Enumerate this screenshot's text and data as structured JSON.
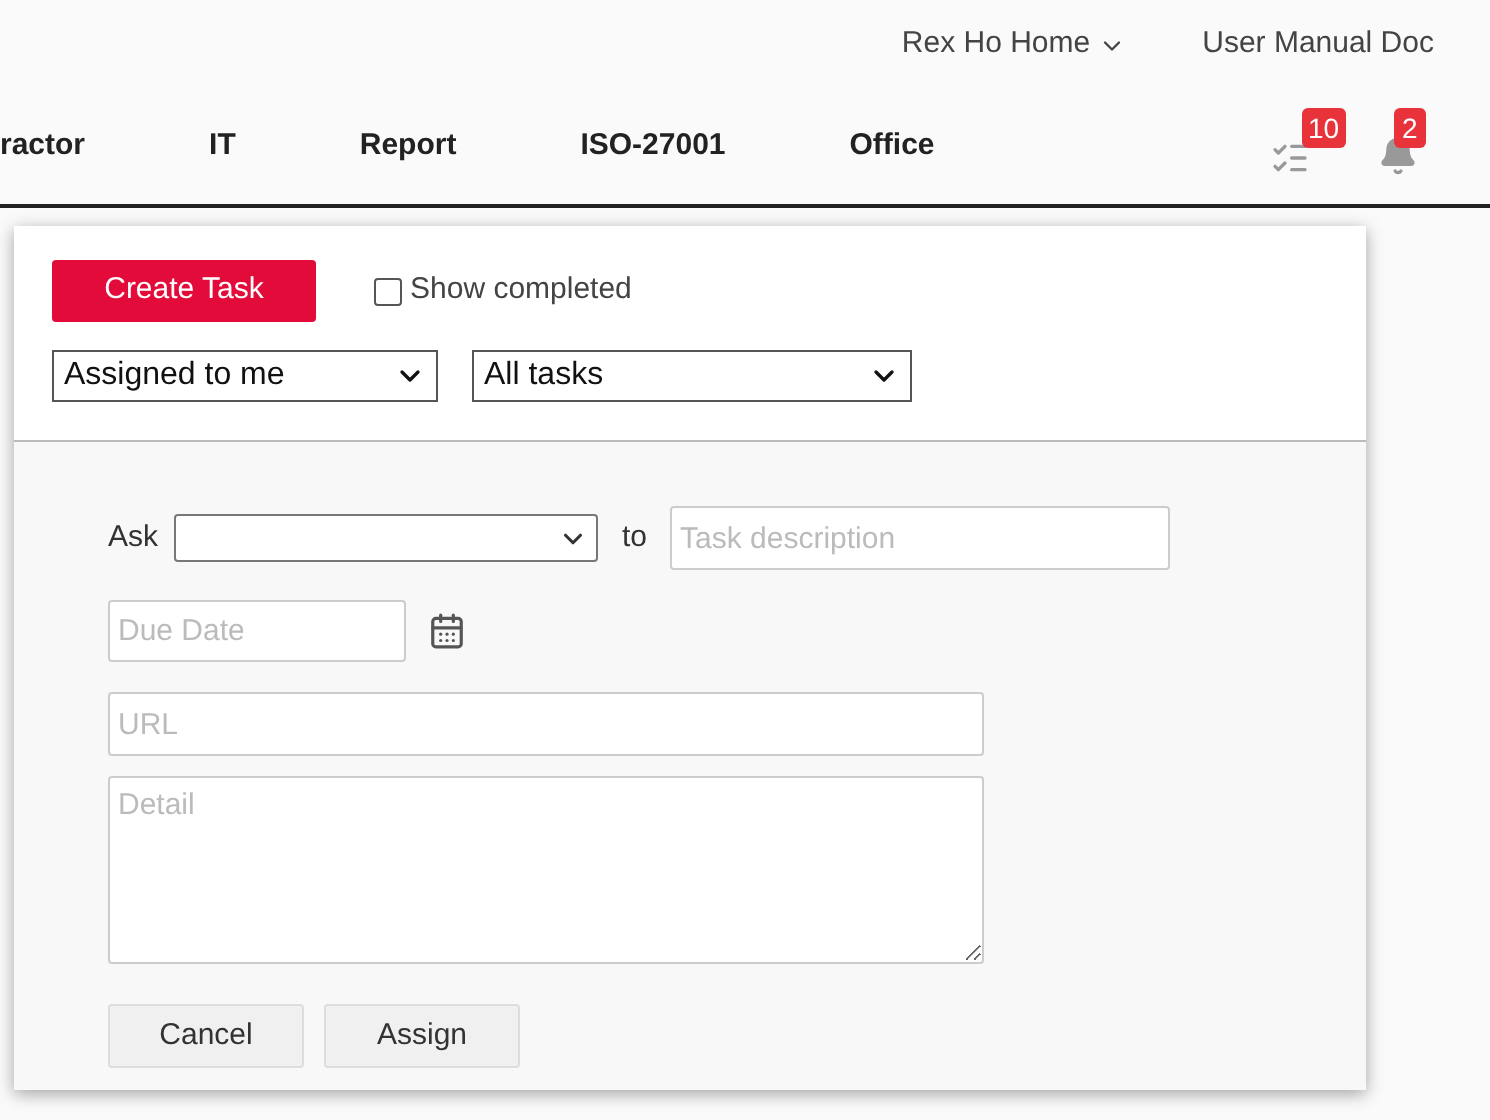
{
  "top_links": [
    {
      "label": "Rex Ho Home",
      "dropdown": true
    },
    {
      "label": "User Manual Doc",
      "dropdown": false
    }
  ],
  "nav": [
    "ractor",
    "IT",
    "Report",
    "ISO-27001",
    "Office"
  ],
  "badges": {
    "tasks": "10",
    "notifications": "2"
  },
  "panel": {
    "create_button": "Create Task",
    "show_completed": {
      "label": "Show completed",
      "checked": false
    },
    "filters": [
      "Assigned to me",
      "All tasks"
    ],
    "form": {
      "ask_label": "Ask",
      "to_label": "to",
      "task_placeholder": "Task description",
      "due_placeholder": "Due Date",
      "url_placeholder": "URL",
      "detail_placeholder": "Detail",
      "buttons": [
        "Cancel",
        "Assign"
      ]
    }
  }
}
